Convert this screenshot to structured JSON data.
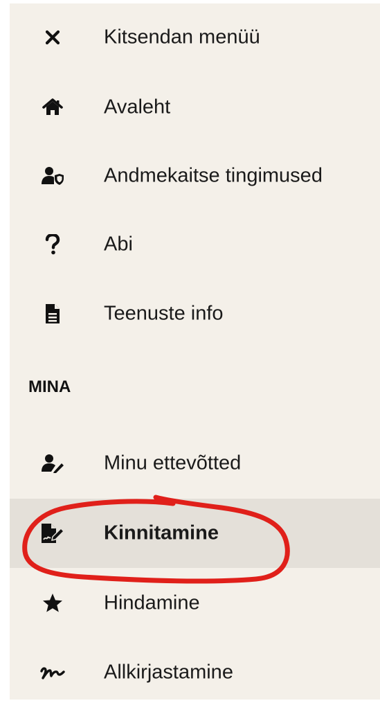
{
  "menu": {
    "items_top": [
      {
        "label": "Kitsendan menüü",
        "icon": "close-icon"
      },
      {
        "label": "Avaleht",
        "icon": "home-icon"
      },
      {
        "label": "Andmekaitse tingimused",
        "icon": "user-shield-icon"
      },
      {
        "label": "Abi",
        "icon": "question-icon"
      },
      {
        "label": "Teenuste info",
        "icon": "document-icon"
      }
    ],
    "section_heading": "MINA",
    "items_section": [
      {
        "label": "Minu ettevõtted",
        "icon": "user-edit-icon"
      },
      {
        "label": "Kinnitamine",
        "icon": "signature-document-icon",
        "active": true
      },
      {
        "label": "Hindamine",
        "icon": "star-icon"
      },
      {
        "label": "Allkirjastamine",
        "icon": "signature-icon"
      }
    ]
  },
  "colors": {
    "menu_background": "#f4f0e9",
    "active_background": "#e4e0d9",
    "annotation_stroke": "#e0201a"
  }
}
